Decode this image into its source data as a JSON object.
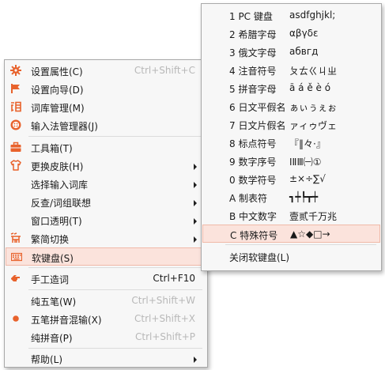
{
  "main_menu": {
    "items": [
      {
        "label": "设置属性(C)",
        "mnemonic": "C",
        "shortcut": "Ctrl+Shift+C",
        "icon": "gear-icon"
      },
      {
        "label": "设置向导(D)",
        "mnemonic": "D",
        "shortcut": "",
        "icon": "flag-icon"
      },
      {
        "label": "词库管理(M)",
        "mnemonic": "M",
        "shortcut": "",
        "icon": "dictionary-icon"
      },
      {
        "label": "输入法管理器(J)",
        "mnemonic": "J",
        "shortcut": "",
        "icon": "manager-icon"
      },
      {
        "label": "工具箱(T)",
        "mnemonic": "T",
        "shortcut": "",
        "icon": "toolbox-icon"
      },
      {
        "label": "更换皮肤(H)",
        "mnemonic": "H",
        "shortcut": "",
        "icon": "shirt-icon"
      },
      {
        "label": "选择输入词库",
        "shortcut": ""
      },
      {
        "label": "反查/词组联想",
        "shortcut": ""
      },
      {
        "label": "窗口透明(T)",
        "mnemonic": "T",
        "shortcut": ""
      },
      {
        "label": "繁简切换",
        "shortcut": "",
        "icon": "traditional-simplified-icon"
      },
      {
        "label": "软键盘(S)",
        "mnemonic": "S",
        "shortcut": "",
        "icon": "keyboard-icon"
      },
      {
        "label": "手工造词",
        "shortcut": "Ctrl+F10",
        "icon": "hand-icon"
      },
      {
        "label": "纯五笔(W)",
        "mnemonic": "W",
        "shortcut": "Ctrl+Shift+W"
      },
      {
        "label": "五笔拼音混输(X)",
        "mnemonic": "X",
        "shortcut": "Ctrl+Shift+X",
        "icon": "radio-dot-icon"
      },
      {
        "label": "纯拼音(P)",
        "mnemonic": "P",
        "shortcut": "Ctrl+Shift+P"
      },
      {
        "label": "帮助(L)",
        "mnemonic": "L",
        "shortcut": ""
      }
    ]
  },
  "soft_keyboard_menu": {
    "items": [
      {
        "label": "1 PC 键盘",
        "sample": "asdfghjkl;"
      },
      {
        "label": "2 希腊字母",
        "sample": "αβγδε"
      },
      {
        "label": "3 俄文字母",
        "sample": "абвгд"
      },
      {
        "label": "4 注音符号",
        "sample": "ㄆㄊㄍㄐㄓ"
      },
      {
        "label": "5 拼音字母",
        "sample": "ā á ě è ó"
      },
      {
        "label": "6 日文平假名",
        "sample": "ぁぃぅぇぉ"
      },
      {
        "label": "7 日文片假名",
        "sample": "ァィゥヴェ"
      },
      {
        "label": "8 标点符号",
        "sample": "『‖々·』"
      },
      {
        "label": "9 数字序号",
        "sample": "ⅠⅡⅢ㈠①"
      },
      {
        "label": "0 数学符号",
        "sample": "±×÷∑√"
      },
      {
        "label": "A 制表符",
        "sample": "┓┿┡┳┿"
      },
      {
        "label": "B 中文数字",
        "sample": "壹贰千万兆"
      },
      {
        "label": "C 特殊符号",
        "sample": "▲☆◆□→"
      },
      {
        "label": "关闭软键盘(L)",
        "mnemonic": "L"
      }
    ]
  },
  "colors": {
    "highlight_bg": "#fbe3dc",
    "highlight_border": "#f0b9a8",
    "icon_orange": "#e8622c",
    "shortcut_gray": "#b8b8b8"
  }
}
